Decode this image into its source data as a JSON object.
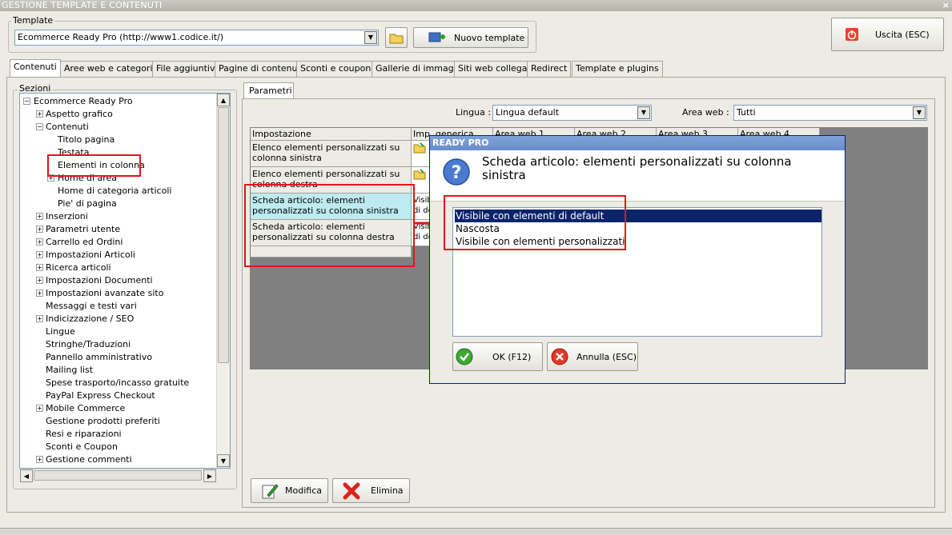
{
  "window": {
    "title": "GESTIONE TEMPLATE E CONTENUTI",
    "close_glyph": "×"
  },
  "template_group": {
    "label": "Template",
    "selected": "Ecommerce Ready Pro (http://www1.codice.it/)",
    "new_button": "Nuovo template"
  },
  "exit_button": "Uscita (ESC)",
  "tabs": [
    "Contenuti",
    "Aree web e categorie",
    "File aggiuntivi",
    "Pagine di contenuti",
    "Sconti e coupon",
    "Gallerie di immagini",
    "Siti web collegati",
    "Redirect",
    "Template e plugins"
  ],
  "sections": {
    "label": "Sezioni",
    "root": "Ecommerce Ready Pro",
    "items": [
      {
        "label": "Aspetto grafico",
        "level": 1,
        "expander": "+"
      },
      {
        "label": "Contenuti",
        "level": 1,
        "expander": "-"
      },
      {
        "label": "Titolo pagina",
        "level": 2,
        "expander": ""
      },
      {
        "label": "Testata",
        "level": 2,
        "expander": ""
      },
      {
        "label": "Elementi in colonna",
        "level": 2,
        "expander": ""
      },
      {
        "label": "Home di area",
        "level": 2,
        "expander": "+"
      },
      {
        "label": "Home di categoria articoli",
        "level": 2,
        "expander": ""
      },
      {
        "label": "Pie' di pagina",
        "level": 2,
        "expander": ""
      },
      {
        "label": "Inserzioni",
        "level": 1,
        "expander": "+"
      },
      {
        "label": "Parametri utente",
        "level": 1,
        "expander": "+"
      },
      {
        "label": "Carrello ed Ordini",
        "level": 1,
        "expander": "+"
      },
      {
        "label": "Impostazioni Articoli",
        "level": 1,
        "expander": "+"
      },
      {
        "label": "Ricerca articoli",
        "level": 1,
        "expander": "+"
      },
      {
        "label": "Impostazioni Documenti",
        "level": 1,
        "expander": "+"
      },
      {
        "label": "Impostazioni avanzate sito",
        "level": 1,
        "expander": "+"
      },
      {
        "label": "Messaggi e testi vari",
        "level": 1,
        "expander": ""
      },
      {
        "label": "Indicizzazione / SEO",
        "level": 1,
        "expander": "+"
      },
      {
        "label": "Lingue",
        "level": 1,
        "expander": ""
      },
      {
        "label": "Stringhe/Traduzioni",
        "level": 1,
        "expander": ""
      },
      {
        "label": "Pannello amministrativo",
        "level": 1,
        "expander": ""
      },
      {
        "label": "Mailing list",
        "level": 1,
        "expander": ""
      },
      {
        "label": "Spese trasporto/incasso gratuite",
        "level": 1,
        "expander": ""
      },
      {
        "label": "PayPal Express Checkout",
        "level": 1,
        "expander": ""
      },
      {
        "label": "Mobile Commerce",
        "level": 1,
        "expander": "+"
      },
      {
        "label": "Gestione prodotti preferiti",
        "level": 1,
        "expander": ""
      },
      {
        "label": "Resi e riparazioni",
        "level": 1,
        "expander": ""
      },
      {
        "label": "Sconti e Coupon",
        "level": 1,
        "expander": ""
      },
      {
        "label": "Gestione commenti",
        "level": 1,
        "expander": "+"
      }
    ]
  },
  "parametri": {
    "tab": "Parametri",
    "lingua_label": "Lingua :",
    "lingua_value": "Lingua default",
    "area_label": "Area web :",
    "area_value": "Tutti",
    "grid": {
      "headers": [
        "Impostazione",
        "Imp. generica",
        "Area web 1",
        "Area web 2",
        "Area web 3",
        "Area web 4"
      ],
      "rows": [
        {
          "label": "Elenco elementi personalizzati su colonna sinistra",
          "value": ""
        },
        {
          "label": "Elenco elementi personalizzati su colonna destra",
          "value": ""
        },
        {
          "label": "Scheda articolo: elementi personalizzati su colonna sinistra",
          "value": "Visibi di de"
        },
        {
          "label": "Scheda articolo: elementi personalizzati su colonna destra",
          "value": "Visibi di de"
        }
      ]
    },
    "modify_button": "Modifica",
    "delete_button": "Elimina"
  },
  "dialog": {
    "title": "READY PRO",
    "question": "Scheda articolo: elementi personalizzati su colonna sinistra",
    "options": [
      "Visibile con elementi di default",
      "Nascosta",
      "Visibile con elementi personalizzati"
    ],
    "selected_index": 0,
    "ok_button": "OK (F12)",
    "cancel_button": "Annulla (ESC)"
  },
  "colors": {
    "selection": "#0a246a",
    "highlight_row": "#bdebf0",
    "annotation_red": "#e3141c"
  }
}
